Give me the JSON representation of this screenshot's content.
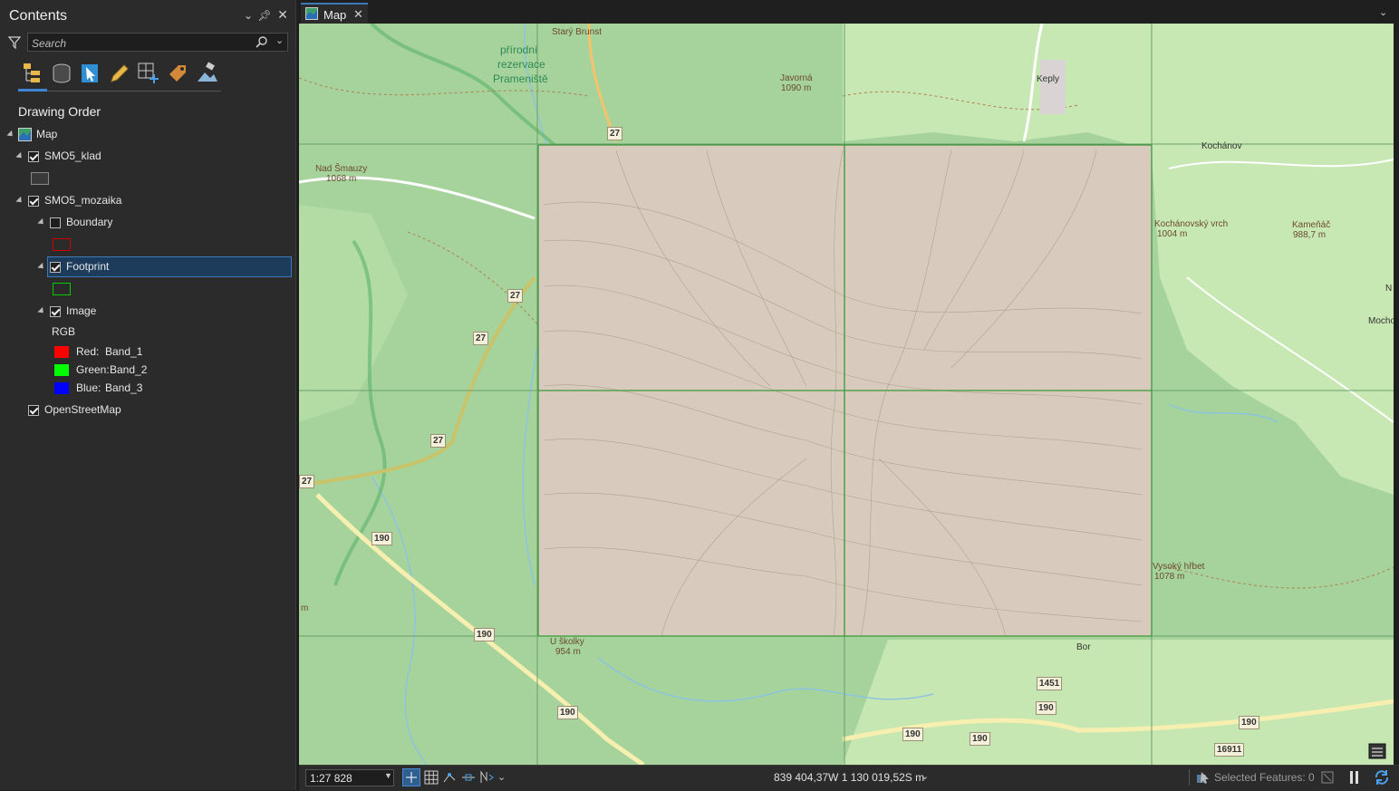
{
  "contents": {
    "title": "Contents",
    "search_placeholder": "Search",
    "section_title": "Drawing Order",
    "toolbar_icons": [
      "list-by-drawing-order-icon",
      "list-by-data-source-icon",
      "list-by-selection-icon",
      "list-by-editing-icon",
      "list-by-snapping-icon",
      "list-by-labeling-icon",
      "list-by-perspective-imagery-icon"
    ],
    "tree": {
      "map": "Map",
      "smo5_klad": "SMO5_klad",
      "smo5_mozaika": "SMO5_mozaika",
      "boundary": "Boundary",
      "footprint": "Footprint",
      "image": "Image",
      "rgb": "RGB",
      "bands": [
        {
          "channel": "Red:",
          "band": "Band_1",
          "color": "#ff0000"
        },
        {
          "channel": "Green:",
          "band": "Band_2",
          "color": "#00ff00"
        },
        {
          "channel": "Blue:",
          "band": "Band_3",
          "color": "#0000ff"
        }
      ],
      "osm": "OpenStreetMap"
    },
    "colors": {
      "boundary": "#cc0000",
      "footprint": "#00cc00",
      "selection": "#1d3c5c"
    }
  },
  "map_tab": {
    "label": "Map"
  },
  "map": {
    "places": [
      {
        "text": "přírodní",
        "cls": "green"
      },
      {
        "text": "rezervace",
        "cls": "green"
      },
      {
        "text": "Prameniště",
        "cls": "green"
      },
      {
        "text": "Starý Brunst"
      },
      {
        "text": "Javorná"
      },
      {
        "text": "1090 m"
      },
      {
        "text": "Keply"
      },
      {
        "text": "Nad Šmauzy"
      },
      {
        "text": "1068 m"
      },
      {
        "text": "Kochánov"
      },
      {
        "text": "Kochánovský vrch"
      },
      {
        "text": "1004 m"
      },
      {
        "text": "Kameňáč"
      },
      {
        "text": "988,7 m"
      },
      {
        "text": "N"
      },
      {
        "text": "Mochov"
      },
      {
        "text": "Vysoký hřbet"
      },
      {
        "text": "1078 m"
      },
      {
        "text": "U školky"
      },
      {
        "text": "954 m"
      },
      {
        "text": "Bor"
      },
      {
        "text": "m"
      }
    ],
    "shields": [
      "27",
      "27",
      "27",
      "27",
      "27",
      "190",
      "190",
      "190",
      "190",
      "190",
      "190",
      "1451",
      "190",
      "16911"
    ]
  },
  "status": {
    "scale": "1:27 828",
    "coordinates": "839 404,37W 1 130 019,52S m",
    "selected_features": "Selected Features: 0"
  }
}
